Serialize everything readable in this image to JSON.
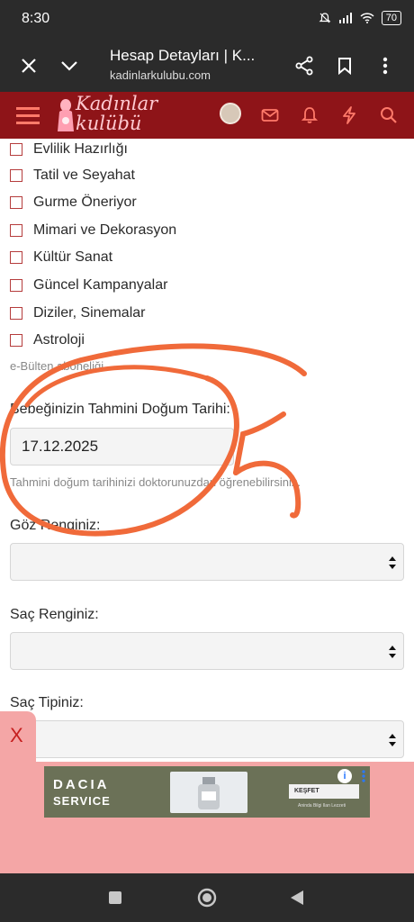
{
  "status_bar": {
    "time": "8:30",
    "battery": "70"
  },
  "browser": {
    "tab_title": "Hesap Detayları | K...",
    "url": "kadinlarkulubu.com",
    "icons": [
      "close-icon",
      "chevron-down-icon",
      "share-icon",
      "bookmark-icon",
      "more-vert-icon"
    ]
  },
  "site_header": {
    "logo_line1": "Kadınlar",
    "logo_line2": "kulübü",
    "icons": [
      "menu-icon",
      "mail-icon",
      "bell-icon",
      "bolt-icon",
      "search-icon"
    ]
  },
  "interests": [
    {
      "label": "Evlilik Hazırlığı"
    },
    {
      "label": "Tatil ve Seyahat"
    },
    {
      "label": "Gurme Öneriyor"
    },
    {
      "label": "Mimari ve Dekorasyon"
    },
    {
      "label": "Kültür Sanat"
    },
    {
      "label": "Güncel Kampanyalar"
    },
    {
      "label": "Diziler, Sinemalar"
    },
    {
      "label": "Astroloji"
    }
  ],
  "newsletter_hint": "e-Bülten aboneliği.",
  "due_date": {
    "label": "Bebeğinizin Tahmini Doğum Tarihi:",
    "value": "17.12.2025",
    "hint": "Tahmini doğum tarihinizi doktorunuzdan öğrenebilirsiniz."
  },
  "eye_color": {
    "label": "Göz Renginiz:",
    "value": ""
  },
  "hair_color": {
    "label": "Saç Renginiz:",
    "value": ""
  },
  "hair_type": {
    "label": "Saç Tipiniz:",
    "value": ""
  },
  "ad": {
    "close": "X",
    "brand": "DACIA",
    "service": "SERVICE",
    "cta": "KEŞFET",
    "fine_print": "Aninda Bilgi Ilan Lezzeti",
    "info": "i"
  },
  "annotation": {
    "text": "5",
    "color": "#f06a3a"
  },
  "colors": {
    "header": "#8e1418",
    "checkbox_border": "#b53c3c",
    "ad_overlay": "#f4a6a6"
  }
}
